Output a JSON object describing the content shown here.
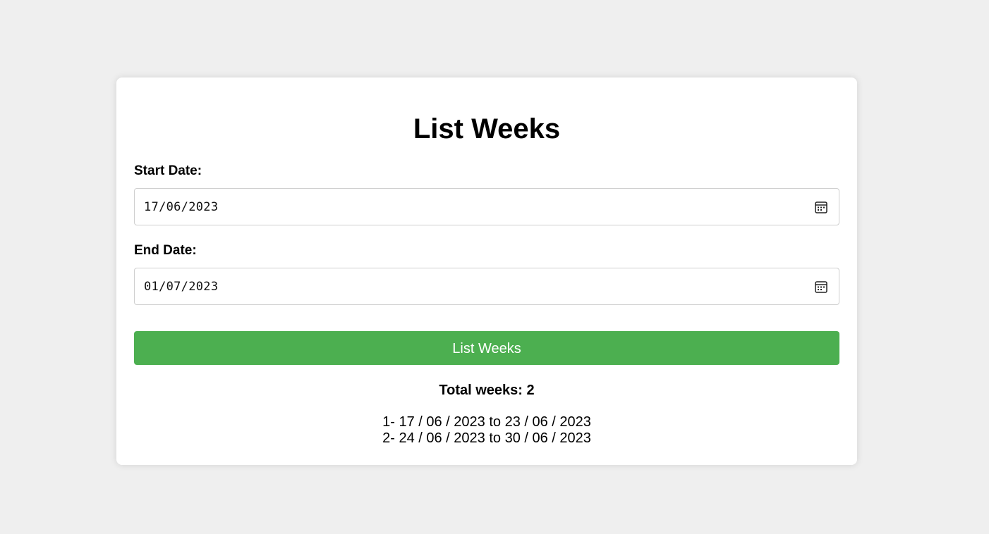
{
  "card": {
    "title": "List Weeks"
  },
  "form": {
    "start_label": "Start Date:",
    "start_value": "17/06/2023",
    "end_label": "End Date:",
    "end_value": "01/07/2023",
    "submit_label": "List Weeks"
  },
  "result": {
    "total_text": "Total weeks: 2",
    "weeks": [
      "1- 17 / 06 / 2023 to 23 / 06 / 2023",
      "2- 24 / 06 / 2023 to 30 / 06 / 2023"
    ]
  },
  "icons": {
    "calendar": "calendar-icon"
  },
  "colors": {
    "background": "#efefef",
    "card": "#ffffff",
    "button": "#4caf50",
    "button_text": "#ffffff"
  }
}
